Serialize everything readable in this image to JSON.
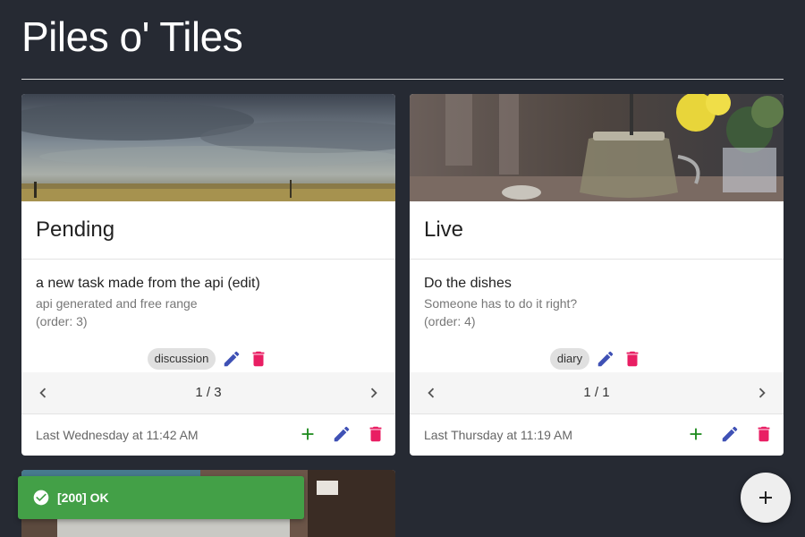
{
  "app": {
    "title": "Piles o' Tiles"
  },
  "colors": {
    "background": "#262a33",
    "edit": "#3f51b5",
    "delete": "#e91e63",
    "add": "#1b8a1b",
    "toast": "#43a047"
  },
  "cards": [
    {
      "heading": "Pending",
      "task": {
        "title": "a new task made from the api (edit)",
        "subtitle": "api generated and free range",
        "order": "(order: 3)"
      },
      "tag": "discussion",
      "pager": "1 / 3",
      "footer": "Last Wednesday at 11:42 AM"
    },
    {
      "heading": "Live",
      "task": {
        "title": "Do the dishes",
        "subtitle": "Someone has to do it right?",
        "order": "(order: 4)"
      },
      "tag": "diary",
      "pager": "1 / 1",
      "footer": "Last Thursday at 11:19 AM"
    }
  ],
  "toast": {
    "message": "[200] OK",
    "icon": "check-circle-icon"
  },
  "fab": {
    "icon": "plus-icon"
  }
}
